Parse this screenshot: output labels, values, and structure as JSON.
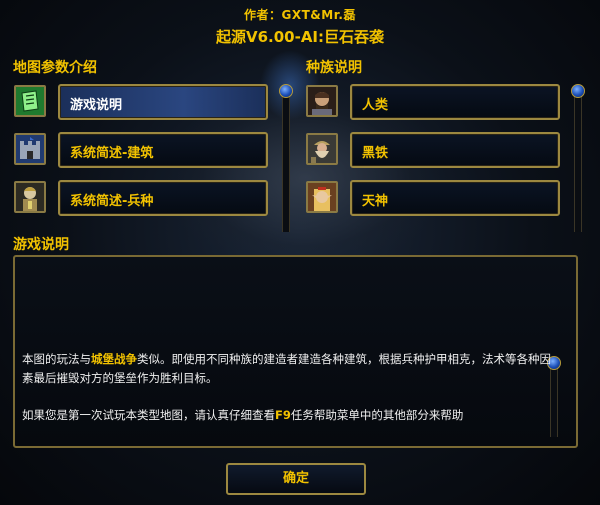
{
  "header": {
    "author": "作者：GXT&Mr.磊",
    "map_title": "起源V6.00-AI:巨石吞袭"
  },
  "left_panel": {
    "title": "地图参数介绍",
    "items": [
      {
        "label": "游戏说明",
        "icon": "green-scroll-icon",
        "selected": true
      },
      {
        "label": "系统简述-建筑",
        "icon": "castle-icon",
        "selected": false
      },
      {
        "label": "系统简述-兵种",
        "icon": "soldier-icon",
        "selected": false
      }
    ]
  },
  "right_panel": {
    "title": "种族说明",
    "items": [
      {
        "label": "人类",
        "icon": "human-hero-icon"
      },
      {
        "label": "黑铁",
        "icon": "dwarf-icon"
      },
      {
        "label": "天神",
        "icon": "elf-icon"
      }
    ]
  },
  "description": {
    "title": "游戏说明",
    "line1_pre": "本图的玩法与",
    "line1_highlight": "城堡战争",
    "line1_post": "类似。即使用不同种族的建造者建造各种建筑，根据兵种护甲相克，法术等各种因素最后摧毁对方的堡垒作为胜利目标。",
    "line2_pre": "如果您是第一次试玩本类型地图，请认真仔细查看",
    "line2_highlight": "F9",
    "line2_post": "任务帮助菜单中的其他部分来帮助"
  },
  "ok_button": {
    "label": "确定"
  },
  "colors": {
    "accent": "#f2c200",
    "border": "#9c8840",
    "selected_bg": "#2a4680"
  }
}
